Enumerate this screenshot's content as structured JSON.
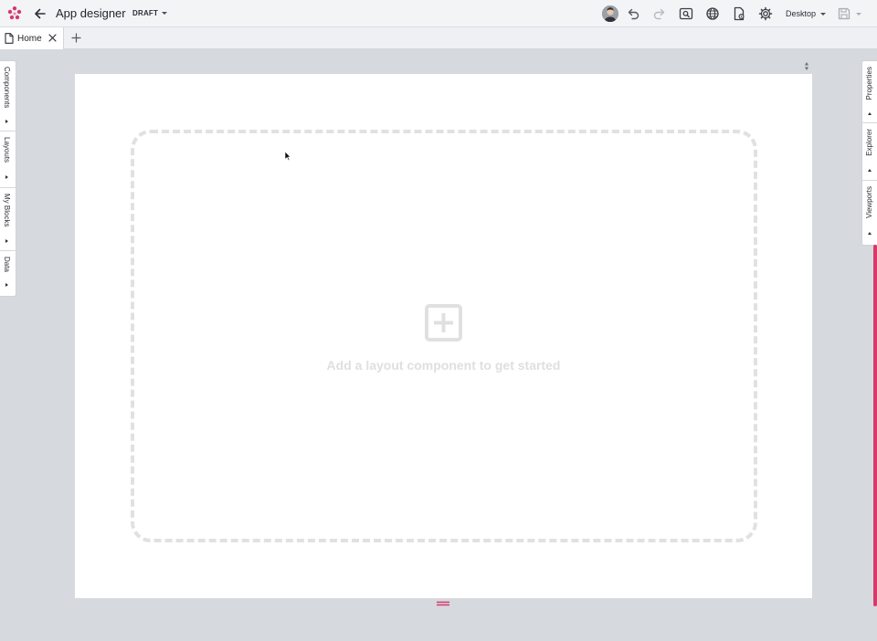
{
  "app": {
    "title": "App designer",
    "status": "DRAFT",
    "brand_color": "#d63a6b"
  },
  "toolbar": {
    "viewport_label": "Desktop",
    "icons": [
      "back-icon",
      "undo-icon",
      "redo-icon",
      "preview-icon",
      "globe-icon",
      "page-settings-icon",
      "gear-icon",
      "save-icon"
    ]
  },
  "tabs": [
    {
      "label": "Home",
      "active": true
    }
  ],
  "left_panels": [
    {
      "label": "Components"
    },
    {
      "label": "Layouts"
    },
    {
      "label": "My Blocks"
    },
    {
      "label": "Data"
    }
  ],
  "right_panels": [
    {
      "label": "Properties"
    },
    {
      "label": "Explorer"
    },
    {
      "label": "Viewports"
    }
  ],
  "canvas": {
    "empty_message": "Add a layout component to get started"
  }
}
